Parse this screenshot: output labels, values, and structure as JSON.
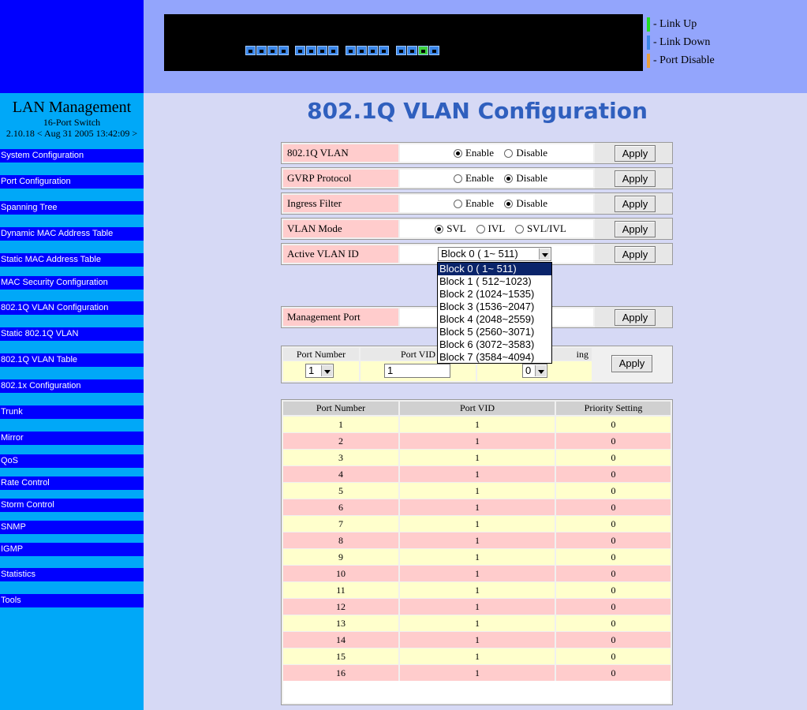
{
  "brand": {
    "title": "LAN Management",
    "model": "16-Port Switch",
    "version": "2.10.18 < Aug 31 2005 13:42:09 >"
  },
  "sidebar": {
    "items": [
      {
        "label": "System Configuration"
      },
      {
        "label": "Port Configuration"
      },
      {
        "label": "Spanning Tree"
      },
      {
        "label": "Dynamic MAC Address Table"
      },
      {
        "label": "Static MAC Address Table"
      },
      {
        "label": "MAC Security Configuration"
      },
      {
        "label": "802.1Q VLAN Configuration"
      },
      {
        "label": "Static 802.1Q VLAN"
      },
      {
        "label": "802.1Q VLAN Table"
      },
      {
        "label": "802.1x Configuration"
      },
      {
        "label": "Trunk"
      },
      {
        "label": "Mirror"
      },
      {
        "label": "QoS"
      },
      {
        "label": "Rate Control"
      },
      {
        "label": "Storm Control"
      },
      {
        "label": "SNMP"
      },
      {
        "label": "IGMP"
      },
      {
        "label": "Statistics"
      },
      {
        "label": " Tools"
      }
    ]
  },
  "legend": {
    "link_up": "- Link Up",
    "link_down": "- Link Down",
    "port_disable": "- Port Disable",
    "colors": {
      "up": "#22dd22",
      "down": "#3a86e8",
      "disable": "#e8a040"
    }
  },
  "ports": {
    "count": 16,
    "up_port": 15
  },
  "page": {
    "title": "802.1Q VLAN Configuration"
  },
  "config": {
    "vlan": {
      "label": "802.1Q VLAN",
      "opt1": "Enable",
      "opt2": "Disable",
      "apply": "Apply"
    },
    "gvrp": {
      "label": "GVRP Protocol",
      "opt1": "Enable",
      "opt2": "Disable",
      "apply": "Apply"
    },
    "ingress": {
      "label": "Ingress Filter",
      "opt1": "Enable",
      "opt2": "Disable",
      "apply": "Apply"
    },
    "mode": {
      "label": "VLAN Mode",
      "opt1": "SVL",
      "opt2": "IVL",
      "opt3": "SVL/IVL",
      "apply": "Apply"
    },
    "active": {
      "label": "Active VLAN ID",
      "value": "Block 0 ( 1~ 511)",
      "apply": "Apply"
    },
    "mgmt": {
      "label": "Management Port",
      "apply": "Apply"
    }
  },
  "dropdown": {
    "options": [
      "Block 0 ( 1~ 511)",
      "Block 1 ( 512~1023)",
      "Block 2 (1024~1535)",
      "Block 3 (1536~2047)",
      "Block 4 (2048~2559)",
      "Block 5 (2560~3071)",
      "Block 6 (3072~3583)",
      "Block 7 (3584~4094)"
    ]
  },
  "pvid_form": {
    "col_port": "Port Number",
    "col_vid": "Port VID",
    "col_prio_visible": "ing",
    "port_value": "1",
    "vid_value": "1",
    "prio_value": "0",
    "apply": "Apply"
  },
  "table": {
    "headers": [
      "Port Number",
      "Port VID",
      "Priority Setting"
    ],
    "rows": [
      [
        "1",
        "1",
        "0"
      ],
      [
        "2",
        "1",
        "0"
      ],
      [
        "3",
        "1",
        "0"
      ],
      [
        "4",
        "1",
        "0"
      ],
      [
        "5",
        "1",
        "0"
      ],
      [
        "6",
        "1",
        "0"
      ],
      [
        "7",
        "1",
        "0"
      ],
      [
        "8",
        "1",
        "0"
      ],
      [
        "9",
        "1",
        "0"
      ],
      [
        "10",
        "1",
        "0"
      ],
      [
        "11",
        "1",
        "0"
      ],
      [
        "12",
        "1",
        "0"
      ],
      [
        "13",
        "1",
        "0"
      ],
      [
        "14",
        "1",
        "0"
      ],
      [
        "15",
        "1",
        "0"
      ],
      [
        "16",
        "1",
        "0"
      ]
    ]
  }
}
